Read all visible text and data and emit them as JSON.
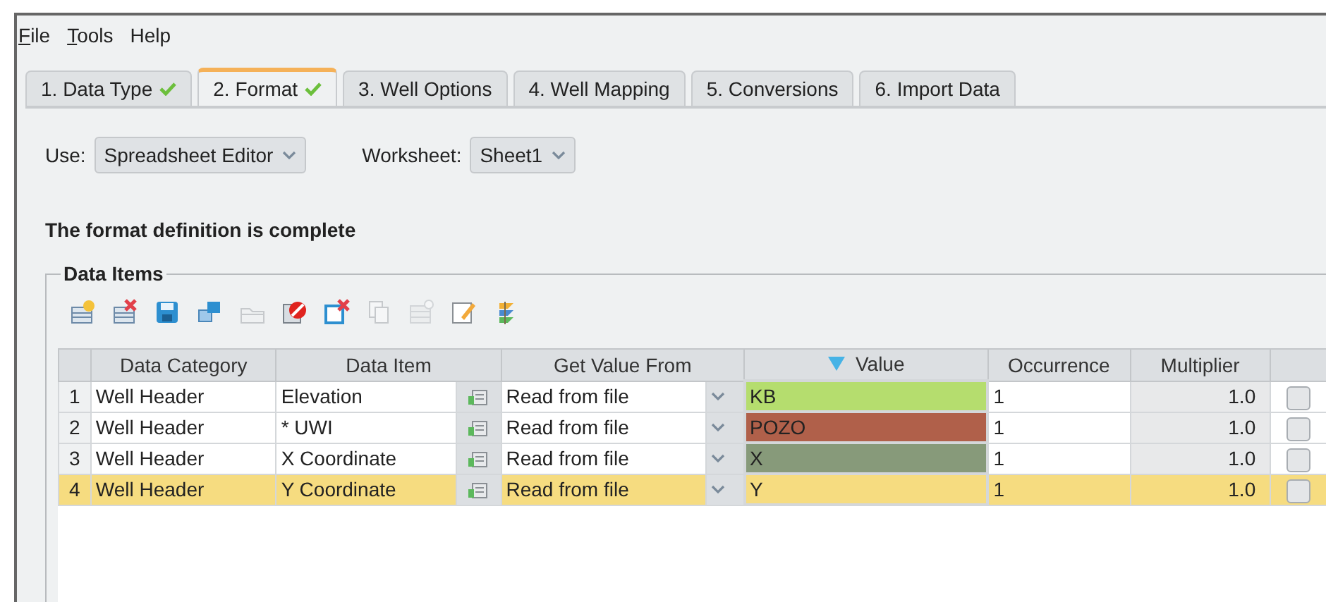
{
  "menu": [
    {
      "label": "File",
      "underline_first": true
    },
    {
      "label": "Tools",
      "underline_first": true
    },
    {
      "label": "Help",
      "underline_first": false
    }
  ],
  "tabs": [
    {
      "label": "1. Data Type",
      "selected": false,
      "complete": true
    },
    {
      "label": "2. Format",
      "selected": true,
      "complete": true
    },
    {
      "label": "3. Well Options",
      "selected": false,
      "complete": false
    },
    {
      "label": "4. Well Mapping",
      "selected": false,
      "complete": false
    },
    {
      "label": "5. Conversions",
      "selected": false,
      "complete": false
    },
    {
      "label": "6. Import Data",
      "selected": false,
      "complete": false
    }
  ],
  "use": {
    "label": "Use:",
    "value": "Spreadsheet Editor"
  },
  "worksheet": {
    "label": "Worksheet:",
    "value": "Sheet1"
  },
  "status_message": "The format definition is complete",
  "data_items": {
    "title": "Data Items",
    "toolbar": [
      {
        "disabled": false
      },
      {
        "disabled": false
      },
      {
        "disabled": false
      },
      {
        "disabled": false
      },
      {
        "disabled": true
      },
      {
        "disabled": false
      },
      {
        "disabled": false
      },
      {
        "disabled": true
      },
      {
        "disabled": true
      },
      {
        "disabled": false
      },
      {
        "disabled": false
      }
    ],
    "columns": [
      "Data Category",
      "Data Item",
      "Get Value From",
      "Value",
      "Occurrence",
      "Multiplier"
    ],
    "rows": [
      {
        "number": "1",
        "category": "Well Header",
        "item": "Elevation",
        "get_value_from": "Read from file",
        "value": "KB",
        "color": "#b5dd6e",
        "occurrence": "1",
        "multiplier": "1.0",
        "checked": false,
        "selected": false
      },
      {
        "number": "2",
        "category": "Well Header",
        "item": "* UWI",
        "get_value_from": "Read from file",
        "value": "POZO",
        "color": "#b0604a",
        "occurrence": "1",
        "multiplier": "1.0",
        "checked": false,
        "selected": false
      },
      {
        "number": "3",
        "category": "Well Header",
        "item": "X Coordinate",
        "get_value_from": "Read from file",
        "value": "X",
        "color": "#879a7a",
        "occurrence": "1",
        "multiplier": "1.0",
        "checked": false,
        "selected": false
      },
      {
        "number": "4",
        "category": "Well Header",
        "item": "Y Coordinate",
        "get_value_from": "Read from file",
        "value": "Y",
        "color": "#f6dc80",
        "occurrence": "1",
        "multiplier": "1.0",
        "checked": false,
        "selected": true
      }
    ]
  }
}
